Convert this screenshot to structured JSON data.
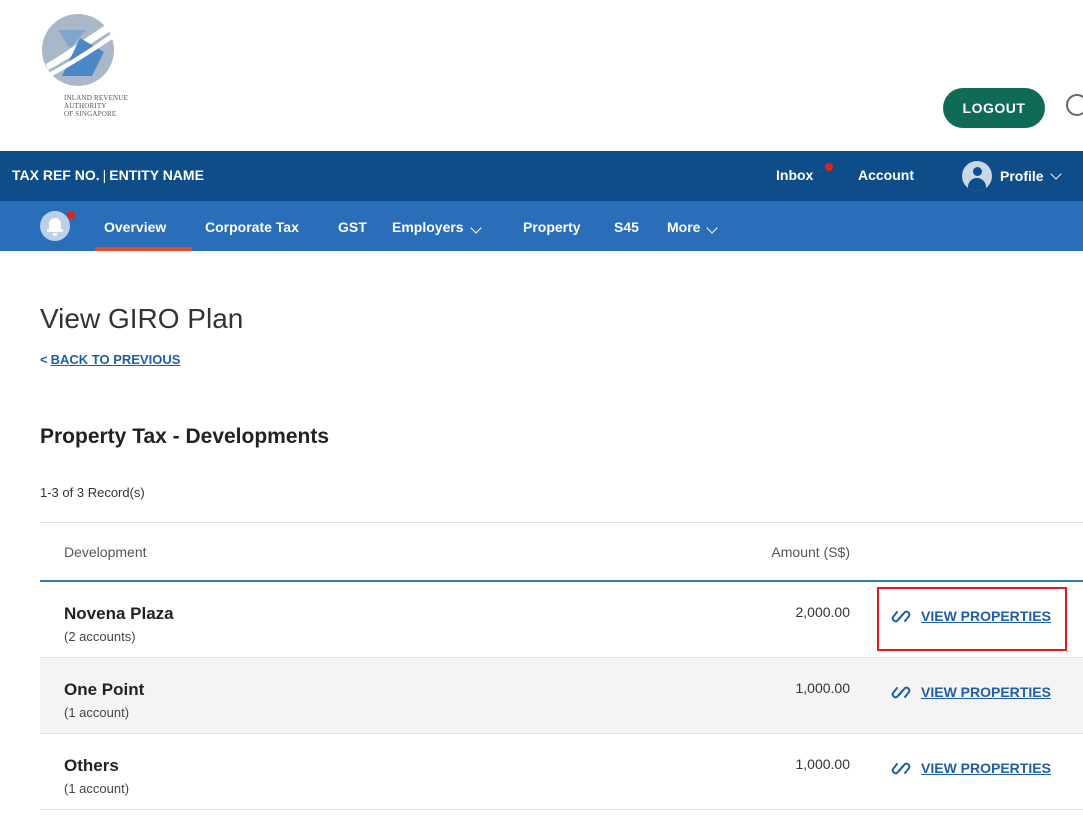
{
  "header": {
    "logo_lines": [
      "INLAND REVENUE",
      "AUTHORITY",
      "OF SINGAPORE"
    ],
    "logout_label": "LOGOUT",
    "colors": {
      "logout": "#0f6b55"
    }
  },
  "topbar": {
    "tax_ref": "TAX REF NO.",
    "separator": "|",
    "entity_name": "ENTITY NAME",
    "inbox_label": "Inbox",
    "account_label": "Account",
    "profile_label": "Profile",
    "colors": {
      "bar": "#0f4c8a",
      "notification_dot": "#e2231a"
    }
  },
  "nav": {
    "items": [
      {
        "label": "Overview",
        "active": true
      },
      {
        "label": "Corporate Tax"
      },
      {
        "label": "GST"
      },
      {
        "label": "Employers",
        "has_dropdown": true
      },
      {
        "label": "Property"
      },
      {
        "label": "S45"
      },
      {
        "label": "More",
        "has_dropdown": true
      }
    ],
    "colors": {
      "bar": "#2a6db8",
      "active_underline": "#e8492f"
    }
  },
  "main": {
    "title": "View GIRO Plan",
    "back_link": "BACK TO PREVIOUS",
    "back_prefix": "<",
    "section_title": "Property Tax - Developments",
    "records_text": "1-3 of 3 Record(s)",
    "table": {
      "columns": [
        "Development",
        "Amount (S$)"
      ],
      "rows": [
        {
          "name": "Novena Plaza",
          "accounts": "(2 accounts)",
          "amount": "2,000.00",
          "link": "VIEW PROPERTIES"
        },
        {
          "name": "One Point",
          "accounts": "(1 account)",
          "amount": "1,000.00",
          "link": "VIEW PROPERTIES"
        },
        {
          "name": "Others",
          "accounts": "(1 account)",
          "amount": "1,000.00",
          "link": "VIEW PROPERTIES"
        }
      ]
    },
    "colors": {
      "link": "#1f5ea8",
      "header_rule": "#2f7bb0",
      "highlight_box": "#e3191b"
    }
  }
}
